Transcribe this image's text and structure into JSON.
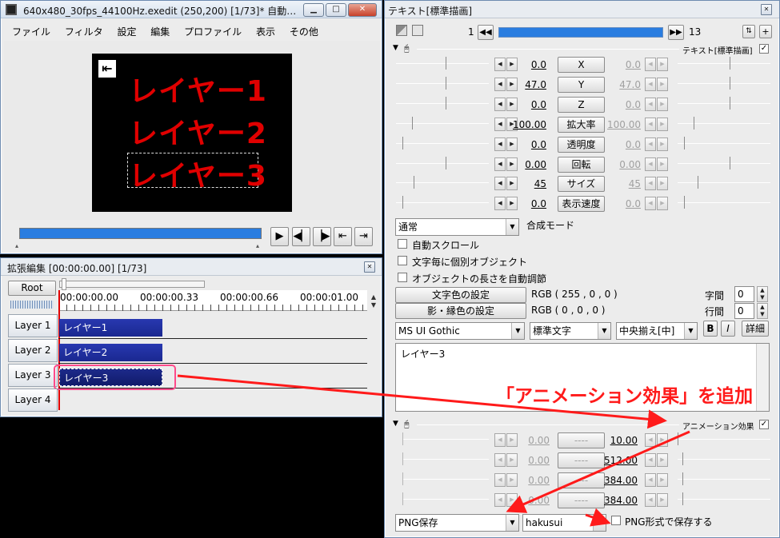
{
  "preview_window": {
    "title": "640x480_30fps_44100Hz.exedit (250,200)  [1/73]*  自動…",
    "menu": [
      "ファイル",
      "フィルタ",
      "設定",
      "編集",
      "プロファイル",
      "表示",
      "その他"
    ],
    "canvas_texts": [
      "レイヤー1",
      "レイヤー2",
      "レイヤー3"
    ],
    "transport_icons": [
      "play-icon",
      "prev-frame-icon",
      "next-frame-icon",
      "go-start-icon",
      "go-end-icon"
    ]
  },
  "timeline_window": {
    "title": "拡張編集 [00:00:00.00] [1/73]",
    "root_label": "Root",
    "timecodes": [
      "00:00:00.00",
      "00:00:00.33",
      "00:00:00.66",
      "00:00:01.00"
    ],
    "layers": [
      {
        "label": "Layer  1",
        "clip": "レイヤー1"
      },
      {
        "label": "Layer  2",
        "clip": "レイヤー2"
      },
      {
        "label": "Layer  3",
        "clip": "レイヤー3"
      },
      {
        "label": "Layer  4",
        "clip": ""
      }
    ]
  },
  "text_window": {
    "title": "テキスト[標準描画]",
    "frame_start": "1",
    "frame_end": "13",
    "section_text": "テキスト[標準描画]",
    "params": [
      {
        "name": "X",
        "left": "0.0",
        "right": "0.0"
      },
      {
        "name": "Y",
        "left": "47.0",
        "right": "47.0"
      },
      {
        "name": "Z",
        "left": "0.0",
        "right": "0.0"
      },
      {
        "name": "拡大率",
        "left": "100.00",
        "right": "100.00"
      },
      {
        "name": "透明度",
        "left": "0.0",
        "right": "0.0"
      },
      {
        "name": "回転",
        "left": "0.00",
        "right": "0.00"
      },
      {
        "name": "サイズ",
        "left": "45",
        "right": "45"
      },
      {
        "name": "表示速度",
        "left": "0.0",
        "right": "0.0"
      }
    ],
    "blend_mode_value": "通常",
    "blend_mode_label": "合成モード",
    "checkboxes": [
      "自動スクロール",
      "文字毎に個別オブジェクト",
      "オブジェクトの長さを自動調節"
    ],
    "text_color_button": "文字色の設定",
    "text_color_value": "RGB ( 255 , 0 , 0 )",
    "shadow_color_button": "影・縁色の設定",
    "shadow_color_value": "RGB ( 0 , 0 , 0 )",
    "char_spacing_label": "字間",
    "char_spacing_value": "0",
    "line_spacing_label": "行間",
    "line_spacing_value": "0",
    "font_value": "MS UI Gothic",
    "style_value": "標準文字",
    "align_value": "中央揃え[中]",
    "bold_label": "B",
    "italic_label": "I",
    "detail_label": "詳細",
    "text_content": "レイヤー3",
    "anim_section": "アニメーション効果",
    "anim_params": [
      {
        "left": "0.00",
        "name": "----",
        "right": "10.00"
      },
      {
        "left": "0.00",
        "name": "----",
        "right": "512.00"
      },
      {
        "left": "0.00",
        "name": "----",
        "right": "384.00"
      },
      {
        "left": "0.00",
        "name": "----",
        "right": "384.00"
      }
    ],
    "anim_type_value": "PNG保存",
    "anim_name_value": "hakusui",
    "png_checkbox_label": "PNG形式で保存する"
  },
  "annotation": {
    "text": "「アニメーション効果」を追加",
    "color": "#ff1a1a"
  }
}
